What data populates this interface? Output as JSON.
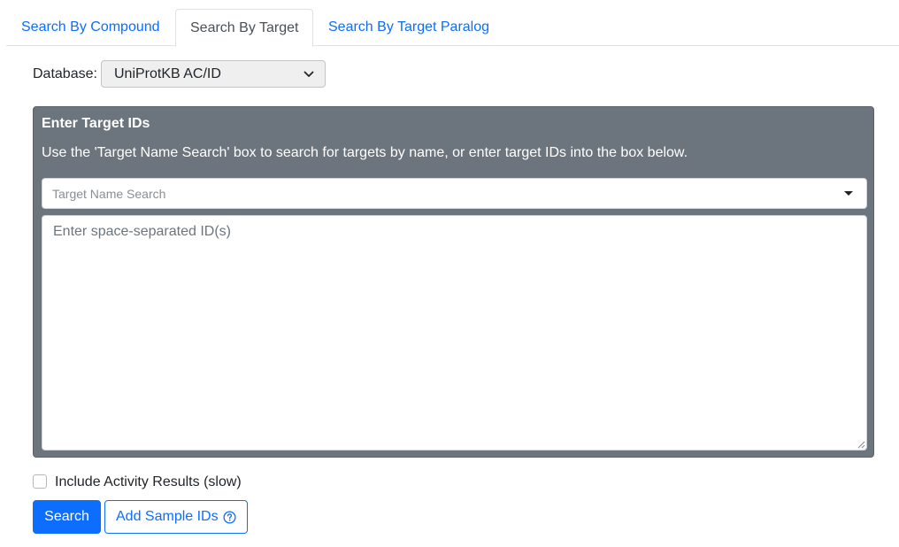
{
  "tabs": [
    {
      "label": "Search By Compound",
      "active": false
    },
    {
      "label": "Search By Target",
      "active": true
    },
    {
      "label": "Search By Target Paralog",
      "active": false
    }
  ],
  "database": {
    "label": "Database:",
    "selected": "UniProtKB AC/ID"
  },
  "panel": {
    "title": "Enter Target IDs",
    "description": "Use the 'Target Name Search' box to search for targets by name, or enter target IDs into the box below.",
    "name_search_placeholder": "Target Name Search",
    "ids_placeholder": "Enter space-separated ID(s)"
  },
  "options": {
    "include_activity_label": "Include Activity Results (slow)",
    "include_activity_checked": false
  },
  "buttons": {
    "search": "Search",
    "add_sample": "Add Sample IDs"
  },
  "icons": {
    "select_chevron": "chevron-down-icon",
    "dropdown_caret": "caret-down-icon",
    "help": "question-circle-icon",
    "resize_grip": "resize-grip-icon"
  },
  "colors": {
    "primary": "#0d6efd",
    "panel_bg": "#6c757d"
  }
}
